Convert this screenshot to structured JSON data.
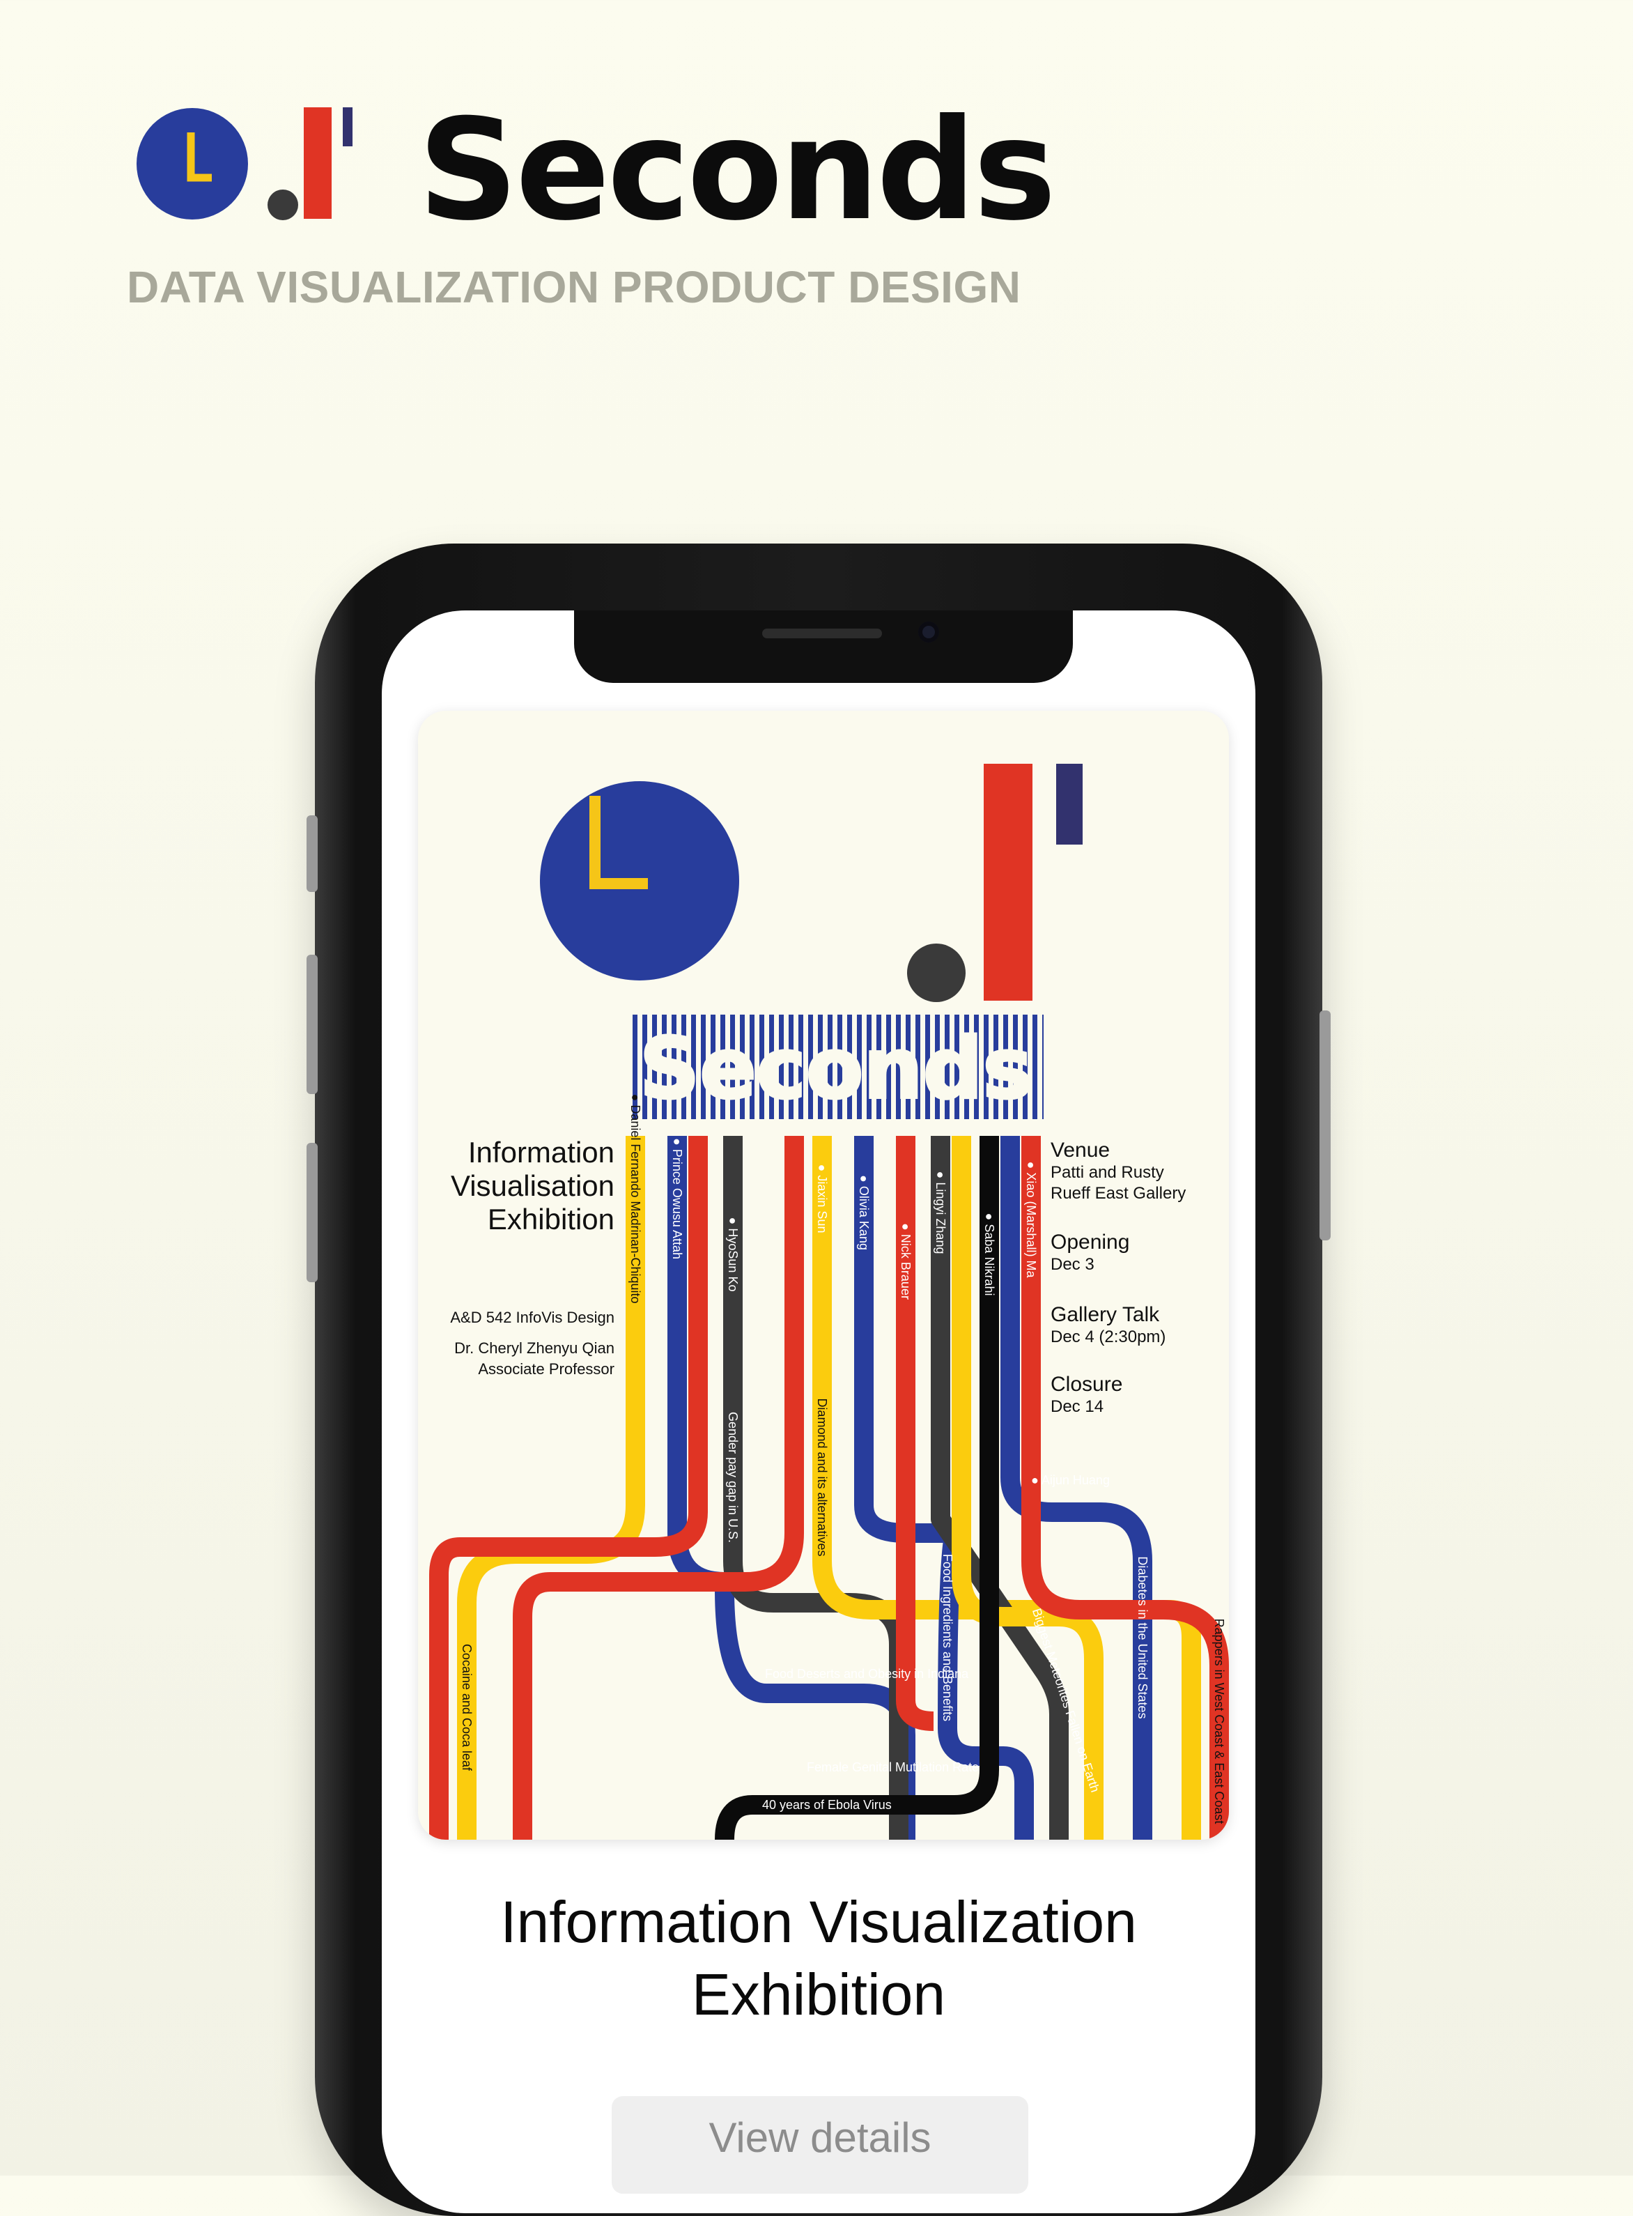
{
  "header": {
    "title": "Seconds",
    "subtitle": "DATA VISUALIZATION PRODUCT DESIGN"
  },
  "colors": {
    "blue": "#283d9c",
    "red": "#e03424",
    "yellow": "#fbcc0e",
    "dark": "#3a3a3a",
    "black": "#0b0b0b",
    "clock_hand": "#f5c518"
  },
  "poster": {
    "wordmark": "Seconds",
    "info_title": [
      "Information",
      "Visualisation",
      "Exhibition"
    ],
    "course": "A&D 542 InfoVis Design",
    "instructor": "Dr. Cheryl Zhenyu Qian",
    "instructor_role": "Associate Professor",
    "venue": {
      "heading": "Venue",
      "lines": [
        "Patti and Rusty",
        "Rueff East Gallery"
      ]
    },
    "events": [
      {
        "heading": "Opening",
        "detail": "Dec 3"
      },
      {
        "heading": "Gallery Talk",
        "detail": "Dec 4 (2:30pm)"
      },
      {
        "heading": "Closure",
        "detail": "Dec 14"
      }
    ],
    "names": [
      "Daniel Fernando Madrinan-Chiquito",
      "Prince Owusu Attah",
      "HyoSun Ko",
      "Jiaxin Sun",
      "Olivia Kang",
      "Nick Brauer",
      "Lingyi Zhang",
      "Saba Nikrahi",
      "Xiao (Marshall) Ma",
      "Aijun Huang"
    ],
    "projects": [
      "Gender pay gap in U.S.",
      "Diamond and its alternatives",
      "Food Ingredients and Benefits",
      "Biggest Meteorites Fallen on Earth",
      "Diabetes in the United States",
      "Rappers in West Coast & East Coast",
      "Cocaine and Coca leaf",
      "Food Deserts and Obesity in Indiana",
      "Female Genital Mutilation Rate",
      "40 years of Ebola Virus"
    ]
  },
  "card": {
    "title_line1": "Information Visualization",
    "title_line2": "Exhibition",
    "button_label": "View details"
  }
}
